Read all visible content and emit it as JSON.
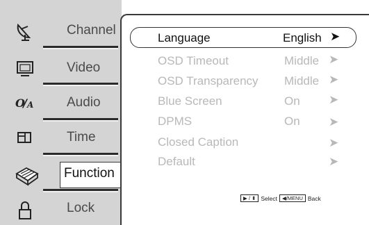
{
  "sidebar": {
    "items": [
      {
        "label": "Channel",
        "icon": "satellite-dish-icon"
      },
      {
        "label": "Video",
        "icon": "monitor-icon"
      },
      {
        "label": "Audio",
        "icon": "audio-icon"
      },
      {
        "label": "Time",
        "icon": "clock-window-icon"
      },
      {
        "label": "Function",
        "icon": "function-box-icon"
      },
      {
        "label": "Lock",
        "icon": "padlock-icon"
      }
    ],
    "active": "Function"
  },
  "menu": {
    "rows": [
      {
        "name": "Language",
        "value": "English",
        "arrow": "➤"
      },
      {
        "name": "OSD Timeout",
        "value": "Middle",
        "arrow": "➤"
      },
      {
        "name": "OSD Transparency",
        "value": "Middle",
        "arrow": "➤"
      },
      {
        "name": "Blue Screen",
        "value": "On",
        "arrow": "➤"
      },
      {
        "name": "DPMS",
        "value": "On",
        "arrow": "➤"
      },
      {
        "name": "Closed Caption",
        "value": "",
        "arrow": "➤"
      },
      {
        "name": "Default",
        "value": "",
        "arrow": "➤"
      }
    ],
    "selected_index": 0
  },
  "hint": {
    "nav_key": "▶ / ⬍",
    "select_label": "Select",
    "back_key": "◀/MENU",
    "back_label": "Back"
  },
  "colors": {
    "sidebar_bg": "#d4d4d4",
    "inactive_text": "#b8b8b8",
    "active_text": "#111111"
  }
}
